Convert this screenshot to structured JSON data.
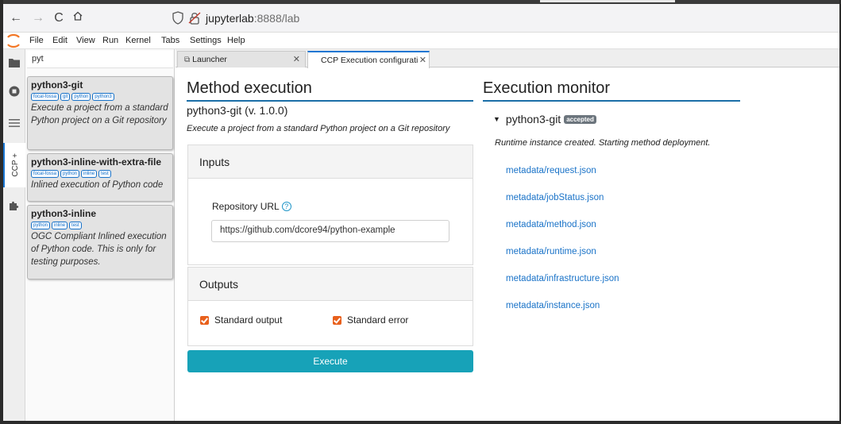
{
  "browser": {
    "back_icon": "arrow-left-icon",
    "url_host": "jupyterlab",
    "url_rest": ":8888/lab"
  },
  "menu": {
    "items": [
      "File",
      "Edit",
      "View",
      "Run",
      "Kernel",
      "Tabs",
      "Settings",
      "Help"
    ]
  },
  "activity": {
    "ccp_label": "CCP +"
  },
  "sidebar": {
    "search_value": "pyt",
    "cards": [
      {
        "title": "python3-git",
        "tags": [
          "focal-fossa",
          "git",
          "python",
          "python3"
        ],
        "description": "Execute a project from a standard Python project on a Git repository"
      },
      {
        "title": "python3-inline-with-extra-file",
        "tags": [
          "focal-fossa",
          "python",
          "inline",
          "test"
        ],
        "description": "Inlined execution of Python code"
      },
      {
        "title": "python3-inline",
        "tags": [
          "python",
          "inline",
          "test"
        ],
        "description": "OGC Compliant Inlined execution of Python code. This is only for testing purposes."
      }
    ]
  },
  "tabs": [
    {
      "label": "Launcher"
    },
    {
      "label": "CCP Execution configuratior"
    }
  ],
  "method": {
    "title": "Method execution",
    "subtitle": "python3-git (v. 1.0.0)",
    "description": "Execute a project from a standard Python project on a Git repository",
    "inputs_header": "Inputs",
    "repo_label": "Repository URL",
    "repo_value": "https://github.com/dcore94/python-example",
    "outputs_header": "Outputs",
    "stdout_label": "Standard output",
    "stderr_label": "Standard error",
    "execute_label": "Execute"
  },
  "monitor": {
    "title": "Execution monitor",
    "job_name": "python3-git",
    "status": "accepted",
    "message": "Runtime instance created. Starting method deployment.",
    "links": [
      "metadata/request.json",
      "metadata/jobStatus.json",
      "metadata/method.json",
      "metadata/runtime.json",
      "metadata/infrastructure.json",
      "metadata/instance.json"
    ]
  },
  "colors": {
    "accent_blue": "#1b6fa8",
    "execute_button": "#17a2b8",
    "checkbox": "#e8601c",
    "badge": "#6c757d",
    "link": "#1a73c8"
  }
}
